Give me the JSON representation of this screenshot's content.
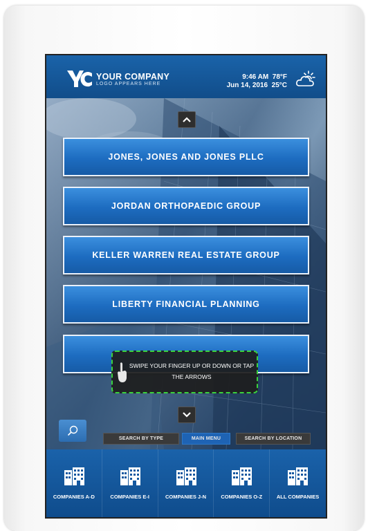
{
  "company": {
    "name": "YOUR COMPANY",
    "tagline": "LOGO APPEARS HERE"
  },
  "status": {
    "time": "9:46 AM",
    "temp_f": "78°F",
    "date": "Jun 14, 2016",
    "temp_c": "25°C",
    "weather_icon": "partly-cloudy-icon"
  },
  "directory": {
    "items": [
      "JONES, JONES AND JONES PLLC",
      "JORDAN ORTHOPAEDIC GROUP",
      "KELLER WARREN REAL ESTATE GROUP",
      "LIBERTY FINANCIAL PLANNING",
      ""
    ]
  },
  "hint": {
    "text": "SWIPE YOUR FINGER UP OR DOWN OR TAP THE ARROWS"
  },
  "controls": {
    "search_by_type": "SEARCH BY TYPE",
    "main_menu": "MAIN MENU",
    "search_by_location": "SEARCH BY LOCATION"
  },
  "footer_nav": [
    {
      "label": "COMPANIES A-D"
    },
    {
      "label": "COMPANIES E-I"
    },
    {
      "label": "COMPANIES J-N"
    },
    {
      "label": "COMPANIES O-Z"
    },
    {
      "label": "ALL COMPANIES"
    }
  ],
  "colors": {
    "accent": "#1d6cc0",
    "header": "#114d8a",
    "hint_border": "#3bd23b"
  }
}
